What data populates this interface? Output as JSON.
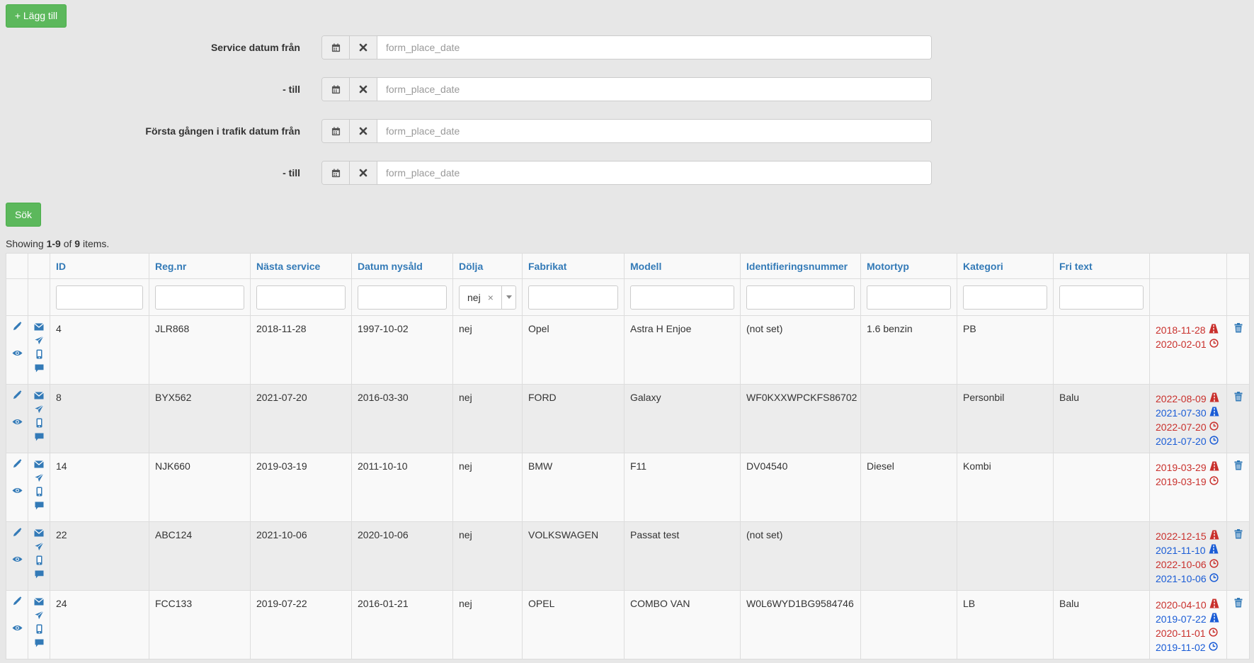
{
  "toolbar": {
    "add_label": "+ Lägg till",
    "search_label": "Sök"
  },
  "filters": [
    {
      "label": "Service datum från",
      "placeholder": "form_place_date"
    },
    {
      "label": "- till",
      "placeholder": "form_place_date"
    },
    {
      "label": "Första gången i trafik datum från",
      "placeholder": "form_place_date"
    },
    {
      "label": "- till",
      "placeholder": "form_place_date"
    }
  ],
  "summary": {
    "prefix": "Showing ",
    "range": "1-9",
    "mid": " of ",
    "total": "9",
    "suffix": " items."
  },
  "table": {
    "headers": [
      "ID",
      "Reg.nr",
      "Nästa service",
      "Datum nysåld",
      "Dölja",
      "Fabrikat",
      "Modell",
      "Identifieringsnummer",
      "Motortyp",
      "Kategori",
      "Fri text"
    ],
    "dolja_filter": "nej",
    "rows": [
      {
        "id": "4",
        "regnr": "JLR868",
        "service": "2018-11-28",
        "nysald": "1997-10-02",
        "dolja": "nej",
        "fabrikat": "Opel",
        "modell": "Astra H Enjoe",
        "ident": "(not set)",
        "motor": "1.6 benzin",
        "kategori": "PB",
        "fritext": "",
        "dates": [
          {
            "d": "2018-11-28",
            "c": "red",
            "i": "road-icon"
          },
          {
            "d": "2020-02-01",
            "c": "red",
            "i": "clock-icon"
          }
        ]
      },
      {
        "id": "8",
        "regnr": "BYX562",
        "service": "2021-07-20",
        "nysald": "2016-03-30",
        "dolja": "nej",
        "fabrikat": "FORD",
        "modell": "Galaxy",
        "ident": "WF0KXXWPCKFS86702",
        "motor": "",
        "kategori": "Personbil",
        "fritext": "Balu",
        "dates": [
          {
            "d": "2022-08-09",
            "c": "red",
            "i": "road-icon"
          },
          {
            "d": "2021-07-30",
            "c": "blue",
            "i": "road-icon"
          },
          {
            "d": "2022-07-20",
            "c": "red",
            "i": "clock-icon"
          },
          {
            "d": "2021-07-20",
            "c": "blue",
            "i": "clock-icon"
          }
        ]
      },
      {
        "id": "14",
        "regnr": "NJK660",
        "service": "2019-03-19",
        "nysald": "2011-10-10",
        "dolja": "nej",
        "fabrikat": "BMW",
        "modell": "F11",
        "ident": "DV04540",
        "motor": "Diesel",
        "kategori": "Kombi",
        "fritext": "",
        "dates": [
          {
            "d": "2019-03-29",
            "c": "red",
            "i": "road-icon"
          },
          {
            "d": "2019-03-19",
            "c": "red",
            "i": "clock-icon"
          }
        ]
      },
      {
        "id": "22",
        "regnr": "ABC124",
        "service": "2021-10-06",
        "nysald": "2020-10-06",
        "dolja": "nej",
        "fabrikat": "VOLKSWAGEN",
        "modell": "Passat test",
        "ident": "(not set)",
        "motor": "",
        "kategori": "",
        "fritext": "",
        "dates": [
          {
            "d": "2022-12-15",
            "c": "red",
            "i": "road-icon"
          },
          {
            "d": "2021-11-10",
            "c": "blue",
            "i": "road-icon"
          },
          {
            "d": "2022-10-06",
            "c": "red",
            "i": "clock-icon"
          },
          {
            "d": "2021-10-06",
            "c": "blue",
            "i": "clock-icon"
          }
        ]
      },
      {
        "id": "24",
        "regnr": "FCC133",
        "service": "2019-07-22",
        "nysald": "2016-01-21",
        "dolja": "nej",
        "fabrikat": "OPEL",
        "modell": "COMBO VAN",
        "ident": "W0L6WYD1BG9584746",
        "motor": "",
        "kategori": "LB",
        "fritext": "Balu",
        "dates": [
          {
            "d": "2020-04-10",
            "c": "red",
            "i": "road-icon"
          },
          {
            "d": "2019-07-22",
            "c": "blue",
            "i": "road-icon"
          },
          {
            "d": "2020-11-01",
            "c": "red",
            "i": "clock-icon"
          },
          {
            "d": "2019-11-02",
            "c": "blue",
            "i": "clock-icon"
          }
        ]
      }
    ]
  },
  "colors": {
    "green": "#5cb85c",
    "link": "#337ab7",
    "date_red": "#c9302c",
    "date_blue": "#1a5cd6"
  }
}
